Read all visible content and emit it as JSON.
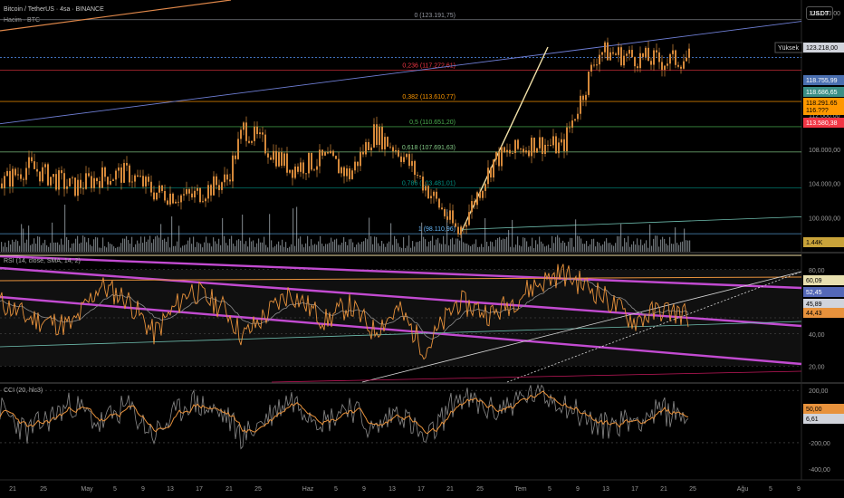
{
  "header": {
    "symbol_line": "Bitcoin / TetherUS · 4sa · BINANCE",
    "volume_label": "Hacim · BTC",
    "currency": "USDT"
  },
  "price_axis": {
    "ticks": [
      "124.000,00",
      "120.000,00",
      "116.000,00",
      "112.000,00",
      "108.000,00",
      "104.000,00",
      "100.000,00"
    ],
    "badges": {
      "high_label": "Yüksek",
      "high_value": "123.218,00",
      "current": "118.755,99",
      "b2": "118.686,65",
      "b3": "118.291,65",
      "b4": "116.???",
      "fib_382": "113.580,38",
      "vol": "1.44K"
    }
  },
  "fib_levels": [
    {
      "label": "0 (123.191,75)",
      "value": 123191.75,
      "color": "#9598a1"
    },
    {
      "label": "0,236 (117.272,61)",
      "value": 117272.61,
      "color": "#f23645"
    },
    {
      "label": "0,382 (113.610,77)",
      "value": 113610.77,
      "color": "#ff9800"
    },
    {
      "label": "0,5 (110.651,20)",
      "value": 110651.2,
      "color": "#4caf50"
    },
    {
      "label": "0,618 (107.691,63)",
      "value": 107691.63,
      "color": "#81c784"
    },
    {
      "label": "0,786 (103.481,01)",
      "value": 103481.01,
      "color": "#009688"
    },
    {
      "label": "1 (98.110,96)",
      "value": 98110.96,
      "color": "#64b5f6"
    }
  ],
  "rsi": {
    "label": "RSI (14, close, SMA, 14, 2)",
    "ticks": [
      "80,00",
      "40,00",
      "20,00"
    ],
    "badges": [
      "60,09",
      "52,45",
      "45,89",
      "44,43"
    ]
  },
  "cci": {
    "label": "CCI (20, hlc3)",
    "ticks": [
      "200,00",
      "-200,00",
      "-400,00"
    ],
    "badges": [
      "50,00",
      "6,61"
    ]
  },
  "time_axis": [
    "21",
    "25",
    "May",
    "5",
    "9",
    "13",
    "17",
    "21",
    "25",
    "Haz",
    "5",
    "9",
    "13",
    "17",
    "21",
    "25",
    "Tem",
    "5",
    "9",
    "13",
    "17",
    "21",
    "25",
    "Ağu",
    "5",
    "9"
  ],
  "colors": {
    "candle": "#d4883a",
    "volume": "#c7d2d8",
    "rsi_line": "#e8923c",
    "rsi_ma": "#8a8a8a",
    "trend_magenta": "#c24bd1",
    "cci_line": "#e8923c"
  },
  "chart_data": [
    {
      "type": "line",
      "title": "Bitcoin / TetherUS · 4sa · BINANCE",
      "ylim": [
        96000,
        125500
      ],
      "x": [
        "21",
        "25",
        "May",
        "5",
        "9",
        "13",
        "17",
        "21",
        "25",
        "Haz",
        "5",
        "9",
        "13",
        "17",
        "21",
        "25",
        "Tem",
        "5",
        "9",
        "13",
        "17",
        "21",
        "25"
      ],
      "series": [
        {
          "values": [
            104000,
            106000,
            103500,
            104800,
            105200,
            103000,
            102400,
            104500,
            110500,
            105800,
            106900,
            105000,
            110000,
            107800,
            103500,
            98200,
            106800,
            108800,
            108200,
            119500,
            118800,
            118300,
            118700
          ]
        }
      ]
    },
    {
      "type": "line",
      "title": "RSI (14, close, SMA, 14, 2)",
      "ylim": [
        10,
        90
      ],
      "series": [
        {
          "values": [
            60,
            50,
            45,
            70,
            62,
            40,
            68,
            55,
            38,
            66,
            48,
            58,
            42,
            55,
            30,
            60,
            52,
            70,
            78,
            66,
            48,
            55,
            52
          ]
        }
      ]
    },
    {
      "type": "line",
      "title": "CCI (20, hlc3)",
      "ylim": [
        -450,
        250
      ],
      "series": [
        {
          "values": [
            60,
            -120,
            100,
            -60,
            80,
            -140,
            120,
            0,
            -160,
            140,
            -40,
            100,
            -120,
            60,
            -200,
            150,
            40,
            180,
            120,
            -80,
            -20,
            40,
            7
          ]
        }
      ]
    }
  ]
}
